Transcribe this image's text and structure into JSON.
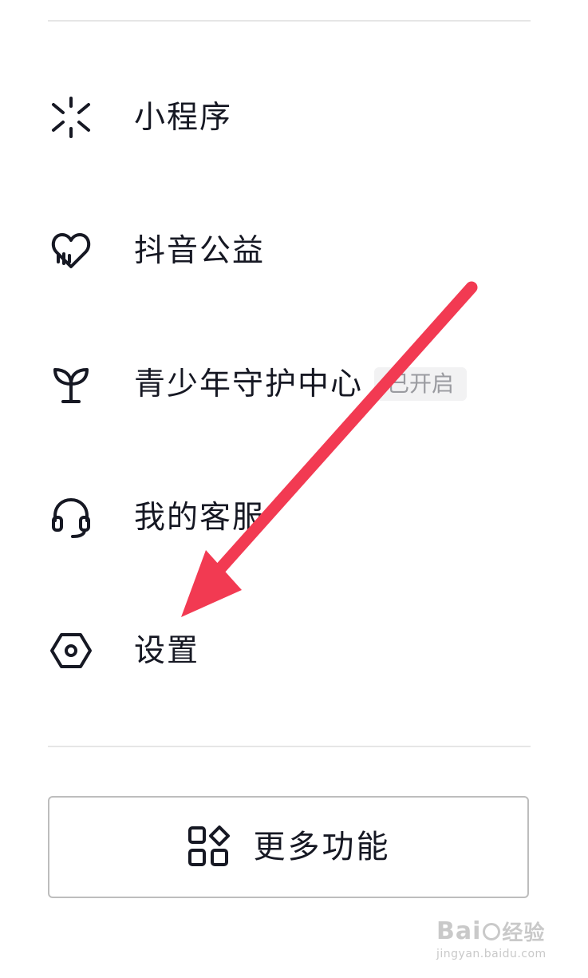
{
  "menu": {
    "items": [
      {
        "label": "小程序",
        "icon": "mini-program-icon"
      },
      {
        "label": "抖音公益",
        "icon": "charity-heart-icon"
      },
      {
        "label": "青少年守护中心",
        "icon": "sprout-icon",
        "badge": "已开启"
      },
      {
        "label": "我的客服",
        "icon": "headset-icon"
      },
      {
        "label": "设置",
        "icon": "settings-hexagon-icon"
      }
    ]
  },
  "more_button": {
    "label": "更多功能",
    "icon": "grid-apps-icon"
  },
  "annotation": {
    "arrow_color": "#f23a52"
  },
  "watermark": {
    "brand": "Bai",
    "brand_suffix": "经验",
    "url": "jingyan.baidu.com"
  },
  "colors": {
    "text": "#161823",
    "badge_bg": "#f2f2f3",
    "badge_text": "#9a9ba0",
    "divider": "#e6e6e6",
    "arrow": "#f23a52"
  }
}
